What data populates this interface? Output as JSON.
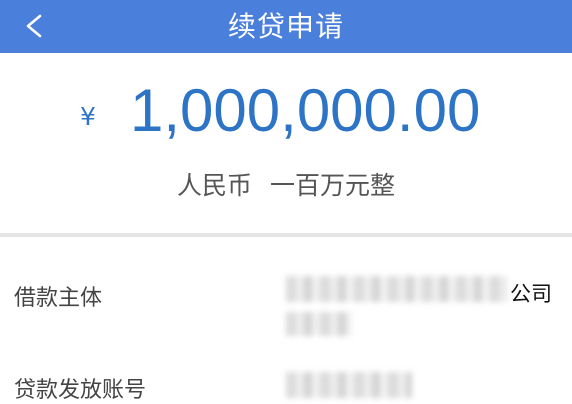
{
  "header": {
    "back_icon": "<",
    "title": "续贷申请"
  },
  "amount": {
    "currency_symbol": "¥",
    "value": "1,000,000.00",
    "currency_name": "人民币",
    "words": "一百万元整"
  },
  "details": {
    "borrower_label": "借款主体",
    "borrower_value_suffix": "公司",
    "account_label": "贷款发放账号"
  },
  "colors": {
    "header_bg": "#4a7fdb",
    "amount_blue": "#2d74c6"
  }
}
